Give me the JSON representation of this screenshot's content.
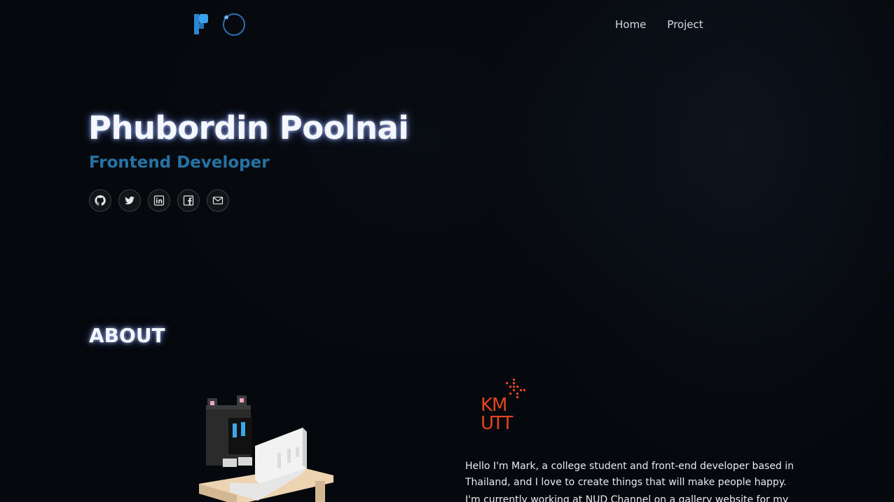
{
  "header": {
    "logo_icon": "pp-logo-icon",
    "nav": [
      {
        "label": "Home"
      },
      {
        "label": "Project"
      }
    ]
  },
  "hero": {
    "name": "Phubordin Poolnai",
    "role": "Frontend Developer",
    "socials": [
      {
        "icon": "github-icon"
      },
      {
        "icon": "twitter-icon"
      },
      {
        "icon": "linkedin-icon"
      },
      {
        "icon": "facebook-icon"
      },
      {
        "icon": "mail-icon"
      }
    ]
  },
  "about": {
    "title": "ABOUT",
    "illustration_icon": "voxel-character-at-desk",
    "university_logo": {
      "line1": "KM",
      "line2": "UTT"
    },
    "paragraphs": [
      "Hello I'm Mark, a college student and front-end developer based in Thailand, and I love to create things that will make people happy.",
      "I'm currently working at NUD Channel on a gallery website for my high"
    ]
  },
  "colors": {
    "background": "#05080c",
    "accent_blue": "#2573a4",
    "kmutt_orange": "#e0461c"
  }
}
